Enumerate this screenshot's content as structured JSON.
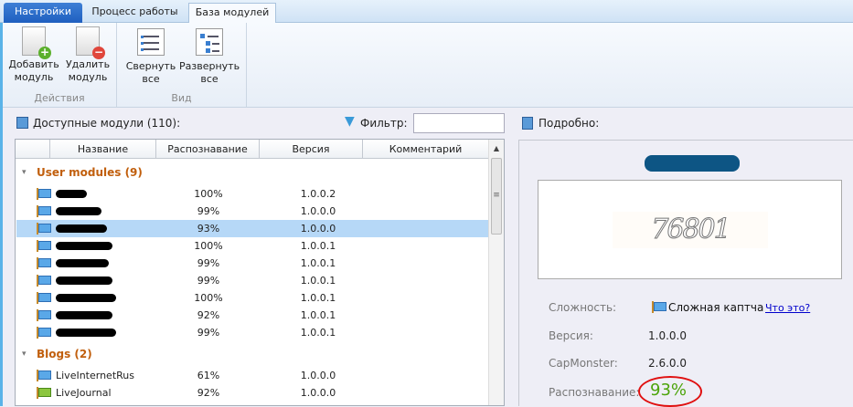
{
  "tabs": [
    "Настройки",
    "Процесс работы",
    "База модулей"
  ],
  "ribbon": {
    "groups": [
      {
        "label": "Действия",
        "buttons": [
          "Добавить модуль",
          "Удалить модуль"
        ]
      },
      {
        "label": "Вид",
        "buttons": [
          "Свернуть все",
          "Развернуть все"
        ]
      }
    ]
  },
  "modules": {
    "title": "Доступные модули (110):",
    "filter_label": "Фильтр:",
    "filter_value": "",
    "columns": [
      "Название",
      "Распознавание",
      "Версия",
      "Комментарий"
    ],
    "groups": [
      {
        "label": "User modules (9)",
        "rows": [
          {
            "name": "",
            "recognition": "100%",
            "version": "1.0.0.2"
          },
          {
            "name": "",
            "recognition": "99%",
            "version": "1.0.0.0"
          },
          {
            "name": "",
            "recognition": "93%",
            "version": "1.0.0.0",
            "selected": true
          },
          {
            "name": "",
            "recognition": "100%",
            "version": "1.0.0.1"
          },
          {
            "name": "",
            "recognition": "99%",
            "version": "1.0.0.1"
          },
          {
            "name": "",
            "recognition": "99%",
            "version": "1.0.0.1"
          },
          {
            "name": "",
            "recognition": "100%",
            "version": "1.0.0.1"
          },
          {
            "name": "",
            "recognition": "92%",
            "version": "1.0.0.1"
          },
          {
            "name": "",
            "recognition": "99%",
            "version": "1.0.0.1"
          }
        ]
      },
      {
        "label": "Blogs (2)",
        "rows": [
          {
            "name": "LiveInternetRus",
            "recognition": "61%",
            "version": "1.0.0.0"
          },
          {
            "name": "LiveJournal",
            "recognition": "92%",
            "version": "1.0.0.0"
          }
        ]
      }
    ]
  },
  "detail": {
    "title": "Подробно:",
    "captcha_text": "76801",
    "complexity_label": "Сложность:",
    "complexity_value": "Сложная каптча",
    "whats_this": "Что это?",
    "version_label": "Версия:",
    "version_value": "1.0.0.0",
    "capmonster_label": "CapMonster:",
    "capmonster_value": "2.6.0.0",
    "recognition_label": "Распознавание:",
    "recognition_value": "93%"
  },
  "colors": {
    "accent": "#1f5fc0",
    "group": "#c15f0d",
    "selected": "#b6d8f7",
    "recognition": "#4ca40a"
  }
}
